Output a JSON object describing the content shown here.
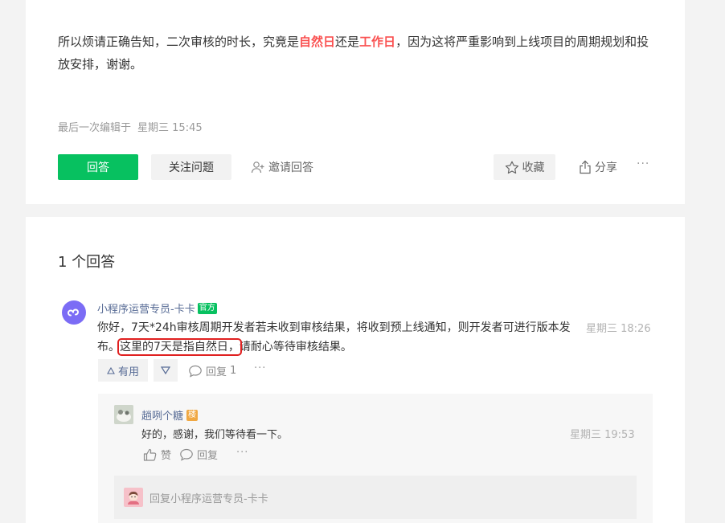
{
  "question": {
    "text_before_1": "所以烦请正确告知，二次审核的时长，究竟是",
    "highlight_1": "自然日",
    "text_between": "还是",
    "highlight_2": "工作日",
    "text_after": "，因为这将严重影响到上线项目的周期规划和投放安排，谢谢。",
    "edited_label": "最后一次编辑于",
    "edited_time": "星期三 15:45",
    "highlight_color": "#fa5151"
  },
  "actions": {
    "answer": "回答",
    "follow": "关注问题",
    "invite": "邀请回答",
    "favorite": "收藏",
    "share": "分享",
    "more": "···"
  },
  "answers": {
    "count_label": "1 个回答",
    "items": [
      {
        "author": "小程序运营专员-卡卡",
        "badge": "官方",
        "text_part1": "你好，7天*24h审核周期开发者若未收到审核结果，将收到预上线通知，则开发者可进行版本发布。",
        "text_highlight": "这里的7天是指自然日，",
        "text_part3": "请耐心等待审核结果。",
        "time": "星期三 18:26",
        "useful_label": "有用",
        "reply_label": "回复",
        "reply_count": "1",
        "more": "···",
        "replies": [
          {
            "author": "趟咧个糖",
            "badge": "楼",
            "text": "好的，感谢，我们等待看一下。",
            "time": "星期三 19:53",
            "like_label": "赞",
            "reply_label": "回复",
            "more": "···"
          }
        ],
        "reply_placeholder": "回复小程序运营专员-卡卡"
      }
    ]
  },
  "colors": {
    "primary_green": "#07c160",
    "link_blue": "#576b95",
    "annotation_red": "#e02020",
    "owner_badge": "#f0a843"
  }
}
